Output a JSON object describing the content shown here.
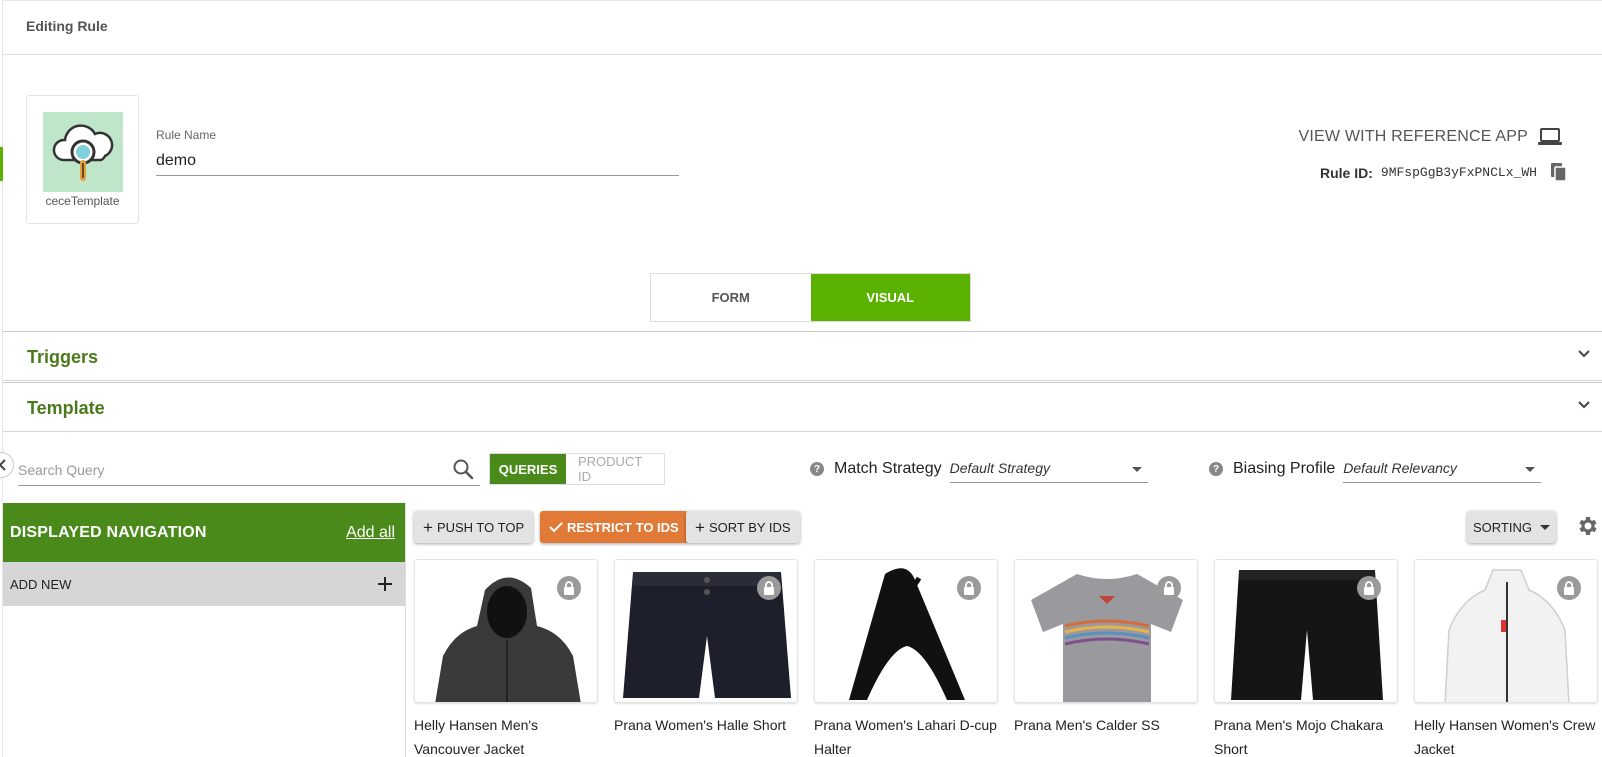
{
  "header": {
    "title": "Editing Rule"
  },
  "template_card": {
    "label": "ceceTemplate",
    "icon": "cloud-search-icon"
  },
  "rule_name": {
    "label": "Rule Name",
    "value": "demo"
  },
  "reference_app": {
    "label": "VIEW WITH REFERENCE APP",
    "icon": "laptop-icon"
  },
  "rule_id": {
    "label": "Rule ID:",
    "value": "9MFspGgB3yFxPNCLx_WH",
    "icon": "copy-icon"
  },
  "mode_toggle": {
    "form": "FORM",
    "visual": "VISUAL",
    "active": "visual"
  },
  "sections": {
    "triggers": "Triggers",
    "template": "Template"
  },
  "search": {
    "placeholder": "Search Query",
    "value": ""
  },
  "search_type": {
    "queries": "QUERIES",
    "product_id": "PRODUCT ID",
    "active": "queries"
  },
  "match_strategy": {
    "label": "Match Strategy",
    "value": "Default Strategy"
  },
  "biasing_profile": {
    "label": "Biasing Profile",
    "value": "Default Relevancy"
  },
  "navigation": {
    "title": "DISPLAYED NAVIGATION",
    "add_all": "Add all",
    "add_new": "ADD NEW"
  },
  "actions": {
    "push_to_top": "PUSH TO TOP",
    "restrict_to_ids": "RESTRICT TO IDS",
    "sort_by_ids": "SORT BY IDS",
    "sorting": "SORTING"
  },
  "colors": {
    "accent_green": "#5bb100",
    "dark_green": "#4a8a1a",
    "orange": "#e07a36"
  },
  "products": [
    {
      "name": "Helly Hansen Men's Vancouver Jacket"
    },
    {
      "name": "Prana Women's Halle Short"
    },
    {
      "name": "Prana Women's Lahari D-cup Halter"
    },
    {
      "name": "Prana Men's Calder SS"
    },
    {
      "name": "Prana Men's Mojo Chakara Short"
    },
    {
      "name": "Helly Hansen Women's Crew Jacket"
    }
  ]
}
